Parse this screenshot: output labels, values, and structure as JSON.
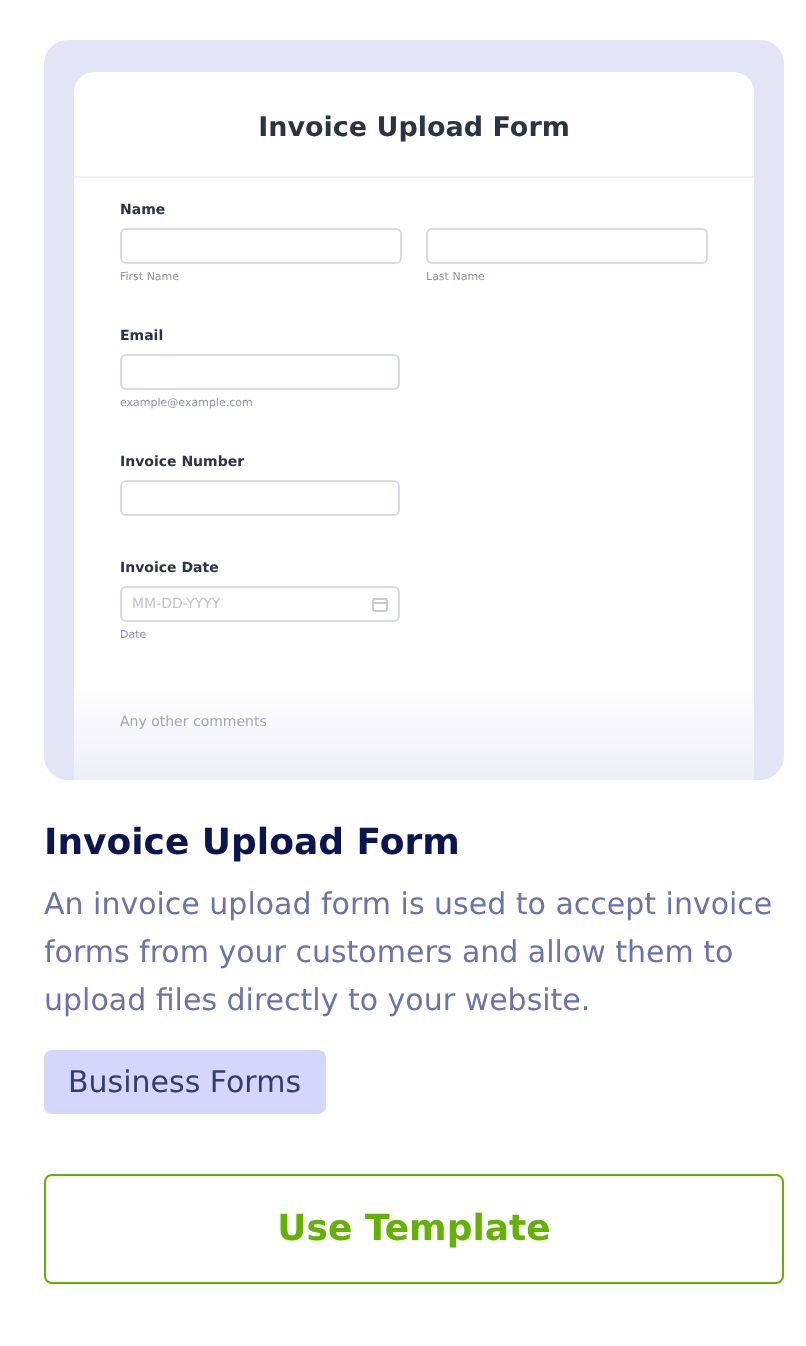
{
  "preview": {
    "title": "Invoice Upload Form",
    "fields": [
      {
        "kind": "name",
        "label": "Name",
        "sublabels": [
          "First Name",
          "Last Name"
        ]
      },
      {
        "kind": "text",
        "label": "Email",
        "sublabels": [
          "example@example.com"
        ]
      },
      {
        "kind": "text",
        "label": "Invoice Number"
      },
      {
        "kind": "date",
        "label": "Invoice Date",
        "placeholder": "MM-DD-YYYY",
        "sublabels": [
          "Date"
        ]
      },
      {
        "kind": "faded",
        "label": "Any other comments"
      }
    ]
  },
  "title": "Invoice Upload Form",
  "description": "An invoice upload form is used to accept invoice forms from your customers and allow them to upload files directly to your website.",
  "tag": "Business Forms",
  "button": "Use Template"
}
